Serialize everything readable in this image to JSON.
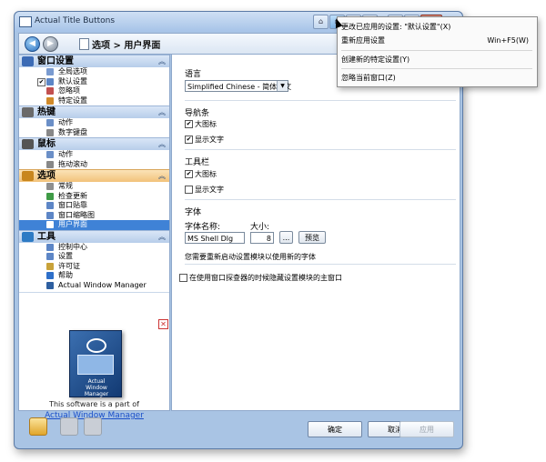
{
  "window": {
    "title": "Actual Title Buttons",
    "titlebar_buttons": [
      "⌂",
      "▫",
      "▭",
      "☐",
      "—",
      "□",
      "✕"
    ]
  },
  "nav": {
    "breadcrumb": "选项 > 用户界面"
  },
  "sidebar": {
    "categories": [
      {
        "label": "窗口设置",
        "color": "#3c6bb5",
        "items": [
          {
            "label": "全局选项",
            "checked": null,
            "selected": false,
            "icon_color": "#7a9bd0"
          },
          {
            "label": "默认设置",
            "checked": true,
            "selected": false,
            "icon_color": "#5d86c6"
          },
          {
            "label": "忽略项",
            "checked": null,
            "selected": false,
            "icon_color": "#c25050"
          },
          {
            "label": "特定设置",
            "checked": null,
            "selected": false,
            "icon_color": "#d08a2a"
          }
        ]
      },
      {
        "label": "热键",
        "color": "#6a6a6a",
        "items": [
          {
            "label": "动作",
            "checked": null,
            "selected": false,
            "icon_color": "#6b8fc7"
          },
          {
            "label": "数字键盘",
            "checked": null,
            "selected": false,
            "icon_color": "#888888"
          }
        ]
      },
      {
        "label": "鼠标",
        "color": "#555555",
        "items": [
          {
            "label": "动作",
            "checked": null,
            "selected": false,
            "icon_color": "#6b8fc7"
          },
          {
            "label": "拖动滚动",
            "checked": null,
            "selected": false,
            "icon_color": "#888888"
          }
        ]
      },
      {
        "label": "选项",
        "color": "#c8861e",
        "highlight": true,
        "items": [
          {
            "label": "常规",
            "checked": null,
            "selected": false,
            "icon_color": "#8f8f8f"
          },
          {
            "label": "检查更新",
            "checked": null,
            "selected": false,
            "icon_color": "#3f9b46"
          },
          {
            "label": "窗口贴靠",
            "checked": null,
            "selected": false,
            "icon_color": "#5d86c6"
          },
          {
            "label": "窗口缩略图",
            "checked": null,
            "selected": false,
            "icon_color": "#5d86c6"
          },
          {
            "label": "用户界面",
            "checked": null,
            "selected": true,
            "icon_color": "#ffffff"
          }
        ]
      },
      {
        "label": "工具",
        "color": "#2e7bc4",
        "items": [
          {
            "label": "控制中心",
            "checked": null,
            "selected": false,
            "icon_color": "#5d86c6"
          },
          {
            "label": "设置",
            "checked": null,
            "selected": false,
            "icon_color": "#5d86c6"
          },
          {
            "label": "许可证",
            "checked": null,
            "selected": false,
            "icon_color": "#c8a23a"
          },
          {
            "label": "帮助",
            "checked": null,
            "selected": false,
            "icon_color": "#2e6fc9"
          },
          {
            "label": "Actual Window Manager",
            "checked": null,
            "selected": false,
            "icon_color": "#2e5fa0"
          }
        ]
      }
    ]
  },
  "promo": {
    "close_glyph": "✕",
    "box_text": "Actual\nWindow Manager",
    "text": "This software is a part of",
    "link": "Actual Window Manager"
  },
  "settings": {
    "language_title": "语言",
    "language_value": "Simplified Chinese - 简体中文",
    "navbar_title": "导航条",
    "nav_big_icons": "大图标",
    "nav_show_text": "显示文字",
    "toolbar_title": "工具栏",
    "tool_big_icons": "大图标",
    "tool_show_text": "显示文字",
    "font_title": "字体",
    "font_name_label": "字体名称:",
    "font_size_label": "大小:",
    "font_name_value": "MS Shell Dlg",
    "font_size_value": "8",
    "browse_label": "...",
    "preview_label": "预览",
    "restart_note": "您需要重新启动设置模块以使用新的字体",
    "hide_main_window": "在使用窗口探查器的时候隐藏设置模块的主窗口"
  },
  "buttons": {
    "ok": "确定",
    "cancel": "取消",
    "apply": "应用"
  },
  "menu": {
    "items": [
      {
        "label": "更改已应用的设置: \"默认设置\"(X)",
        "shortcut": ""
      },
      {
        "label": "重新应用设置",
        "shortcut": "Win+F5(W)"
      },
      {
        "label": "创建新的特定设置(Y)",
        "shortcut": ""
      },
      {
        "label": "忽略当前窗口(Z)",
        "shortcut": ""
      }
    ]
  },
  "colors": {
    "selection": "#3f82d6",
    "link": "#1a4fc9"
  }
}
